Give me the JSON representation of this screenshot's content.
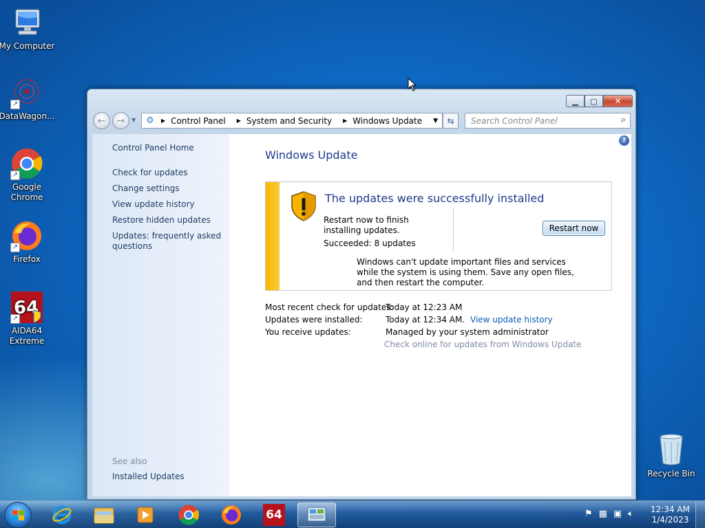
{
  "desktop": {
    "icons": [
      {
        "label": "My Computer",
        "icon": "computer-icon"
      },
      {
        "label": "DataWagon...",
        "icon": "datawagon-icon"
      },
      {
        "label": "Google Chrome",
        "icon": "chrome-icon"
      },
      {
        "label": "Firefox",
        "icon": "firefox-icon"
      },
      {
        "label": "AIDA64 Extreme",
        "icon": "aida64-icon"
      }
    ],
    "recycle_bin": "Recycle Bin"
  },
  "window": {
    "breadcrumb": [
      "Control Panel",
      "System and Security",
      "Windows Update"
    ],
    "search_placeholder": "Search Control Panel",
    "left_pane": {
      "home": "Control Panel Home",
      "links": [
        "Check for updates",
        "Change settings",
        "View update history",
        "Restore hidden updates",
        "Updates: frequently asked questions"
      ],
      "see_also": "See also",
      "see_also_links": [
        "Installed Updates"
      ]
    },
    "main": {
      "title": "Windows Update",
      "status_heading": "The updates were successfully installed",
      "restart_msg": "Restart now to finish installing updates.",
      "succeeded": "Succeeded: 8 updates",
      "restart_button": "Restart now",
      "warning": "Windows can't update important files and services while the system is using them. Save any open files, and then restart the computer.",
      "info": [
        {
          "label": "Most recent check for updates:",
          "value": "Today at 12:23 AM"
        },
        {
          "label": "Updates were installed:",
          "value": "Today at 12:34 AM.",
          "link": "View update history"
        },
        {
          "label": "You receive updates:",
          "value": "Managed by your system administrator"
        }
      ],
      "check_online": "Check online for updates from Windows Update"
    }
  },
  "taskbar": {
    "clock_time": "12:34 AM",
    "clock_date": "1/4/2023",
    "aida_label": "64"
  },
  "colors": {
    "accent": "#1e3a8a",
    "link": "#0a5bb5",
    "stripe": "#f5b800"
  }
}
